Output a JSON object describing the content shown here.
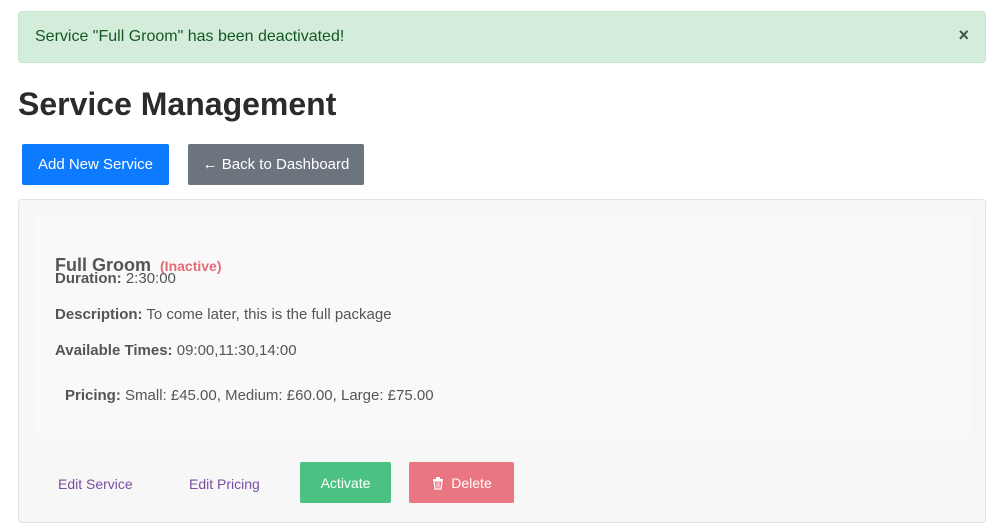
{
  "alert": {
    "message": "Service \"Full Groom\" has been deactivated!",
    "close_symbol": "×"
  },
  "page": {
    "title": "Service Management"
  },
  "actions": {
    "add_label": "Add New Service",
    "back_label": "← Back to Dashboard"
  },
  "service": {
    "name": "Full Groom",
    "status": "(Inactive)",
    "duration_label": "Duration:",
    "duration": "2:30:00",
    "description_label": "Description:",
    "description": "To come later, this is the full package",
    "times_label": "Available Times:",
    "times": "09:00,11:30,14:00",
    "pricing_label": "Pricing:",
    "pricing": "Small: £45.00, Medium: £60.00, Large: £75.00"
  },
  "service_actions": {
    "edit_service": "Edit Service",
    "edit_pricing": "Edit Pricing",
    "activate": "Activate",
    "delete": "Delete",
    "delete_icon": "trash-icon"
  },
  "colors": {
    "primary": "#0d7bff",
    "secondary": "#6c757d",
    "success": "#4cc282",
    "danger": "#ea7681",
    "alert_bg": "#d4edda",
    "inactive": "#e06c75"
  }
}
